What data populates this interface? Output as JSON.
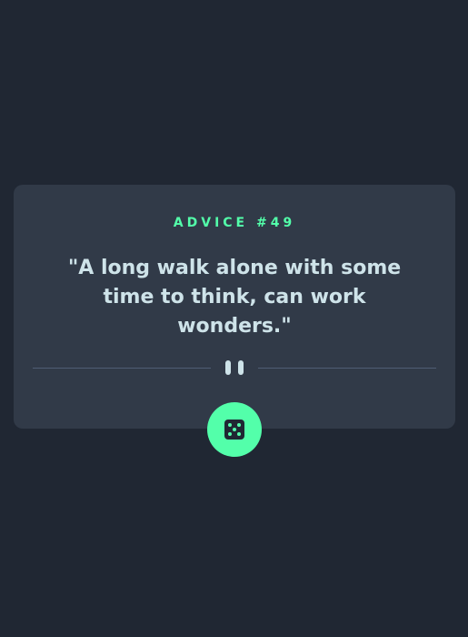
{
  "advice": {
    "id_label": "ADVICE #49",
    "text": "\"A long walk alone with some time to think, can work wonders.\""
  },
  "colors": {
    "background": "#202733",
    "card": "#313a48",
    "accent": "#53ffaa",
    "text": "#cee3e9",
    "divider": "#4f5d74"
  },
  "icons": {
    "divider": "pause-icon",
    "button": "dice-icon"
  }
}
